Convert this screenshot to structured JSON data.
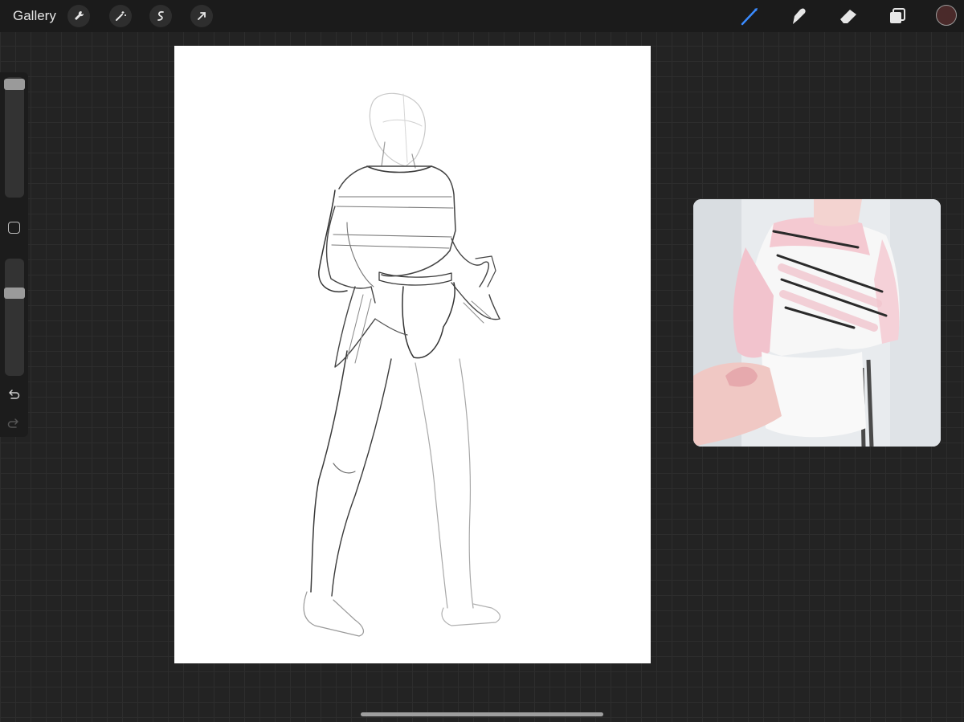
{
  "topbar": {
    "gallery_label": "Gallery",
    "left_tools": [
      "wrench-icon",
      "magic-wand-icon",
      "selection-icon",
      "transform-arrow-icon"
    ],
    "right_tools": [
      "brush-icon",
      "smudge-icon",
      "eraser-icon",
      "layers-icon"
    ],
    "active_tool": "brush-icon",
    "active_color": "#4a2a2a",
    "accent_color": "#3a8bff"
  },
  "sidebar": {
    "controls": [
      "brush-size-slider",
      "modify-button",
      "opacity-slider",
      "undo-icon",
      "redo-icon"
    ]
  },
  "canvas": {
    "background": "#ffffff"
  },
  "reference": {
    "palette": [
      "#f2c6cf",
      "#ffffff",
      "#2a2a2a"
    ]
  }
}
